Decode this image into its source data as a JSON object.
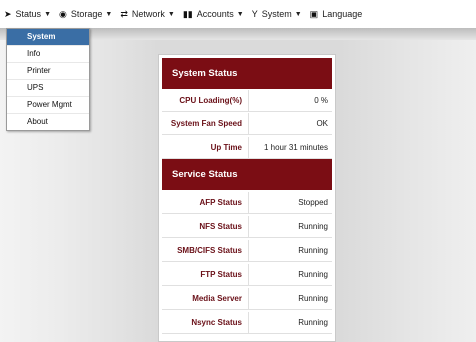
{
  "nav": {
    "items": [
      {
        "label": "Status",
        "icon": "speedometer-icon",
        "caret": true
      },
      {
        "label": "Storage",
        "icon": "disk-icon",
        "caret": true
      },
      {
        "label": "Network",
        "icon": "network-icon",
        "caret": true
      },
      {
        "label": "Accounts",
        "icon": "accounts-icon",
        "caret": true
      },
      {
        "label": "System",
        "icon": "system-icon",
        "caret": true
      },
      {
        "label": "Language",
        "icon": "language-icon",
        "caret": false
      }
    ]
  },
  "dropdown": {
    "items": [
      "System",
      "Info",
      "Printer",
      "UPS",
      "Power Mgmt",
      "About"
    ]
  },
  "system_status": {
    "title": "System Status",
    "rows": [
      {
        "key": "CPU Loading(%)",
        "value": "0 %"
      },
      {
        "key": "System Fan Speed",
        "value": "OK"
      },
      {
        "key": "Up Time",
        "value": "1 hour 31 minutes"
      }
    ]
  },
  "service_status": {
    "title": "Service Status",
    "rows": [
      {
        "key": "AFP Status",
        "value": "Stopped"
      },
      {
        "key": "NFS Status",
        "value": "Running"
      },
      {
        "key": "SMB/CIFS Status",
        "value": "Running"
      },
      {
        "key": "FTP Status",
        "value": "Running"
      },
      {
        "key": "Media Server",
        "value": "Running"
      },
      {
        "key": "Nsync Status",
        "value": "Running"
      }
    ]
  },
  "colors": {
    "header_bg": "#7b0d14",
    "label_text": "#6a1018",
    "menu_active": "#3a6ea5"
  }
}
